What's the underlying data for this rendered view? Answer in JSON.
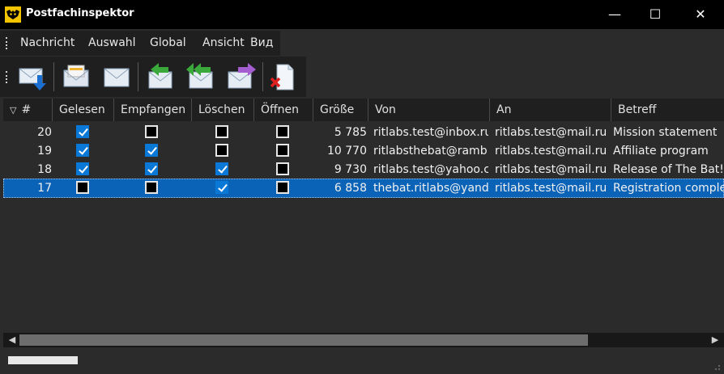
{
  "window": {
    "title": "Postfachinspektor",
    "minimize_glyph": "—",
    "maximize_glyph": "☐",
    "close_glyph": "✕"
  },
  "menu": {
    "items": [
      "Nachricht",
      "Auswahl",
      "Global",
      "Ansicht",
      "Вид"
    ]
  },
  "toolbar": {
    "buttons": [
      "get-mail-icon",
      "open-message-icon",
      "envelope-icon",
      "reply-icon",
      "reply-all-icon",
      "forward-icon",
      "delete-icon"
    ]
  },
  "table": {
    "sort_glyph": "▽",
    "columns": [
      "#",
      "Gelesen",
      "Empfangen",
      "Löschen",
      "Öffnen",
      "Größe",
      "Von",
      "An",
      "Betreff"
    ],
    "rows": [
      {
        "num": "20",
        "read": true,
        "received": false,
        "delete": false,
        "open": false,
        "size": "5 785",
        "from": "ritlabs.test@inbox.ru",
        "to": "ritlabs.test@mail.ru",
        "subject": "Mission statement",
        "selected": false
      },
      {
        "num": "19",
        "read": true,
        "received": true,
        "delete": false,
        "open": false,
        "size": "10 770",
        "from": "ritlabsthebat@ramb…",
        "to": "ritlabs.test@mail.ru",
        "subject": "Affiliate program",
        "selected": false
      },
      {
        "num": "18",
        "read": true,
        "received": true,
        "delete": true,
        "open": false,
        "size": "9 730",
        "from": "ritlabs.test@yahoo.c…",
        "to": "ritlabs.test@mail.ru",
        "subject": "Release of The Bat! v",
        "selected": false
      },
      {
        "num": "17",
        "read": false,
        "received": false,
        "delete": true,
        "open": false,
        "size": "6 858",
        "from": "thebat.ritlabs@yand…",
        "to": "ritlabs.test@mail.ru",
        "subject": "Registration comple",
        "selected": true
      }
    ]
  },
  "scrollbar": {
    "left_arrow": "◀",
    "right_arrow": "▶"
  },
  "colors": {
    "selection": "#0b63b8",
    "checkbox_checked": "#0a78d7"
  }
}
